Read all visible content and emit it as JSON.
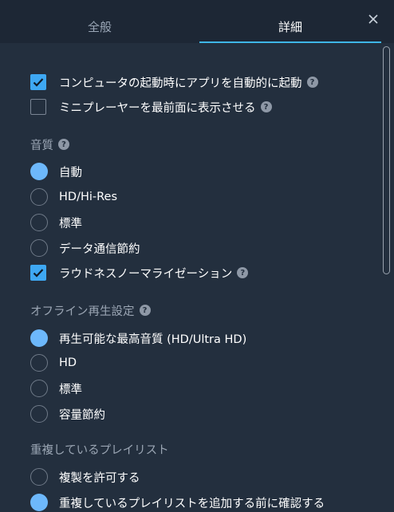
{
  "tabs": {
    "general": "全般",
    "advanced": "詳細"
  },
  "close_icon": "close-icon",
  "help_icon_text": "?",
  "startup": {
    "launch_on_startup": {
      "label": "コンピュータの起動時にアプリを自動的に起動",
      "checked": true
    },
    "mini_player_on_top": {
      "label": "ミニプレーヤーを最前面に表示させる",
      "checked": false
    }
  },
  "audio_quality": {
    "title": "音質",
    "options": [
      "自動",
      "HD/Hi-Res",
      "標準",
      "データ通信節約"
    ],
    "selected": "自動",
    "loudness": {
      "label": "ラウドネスノーマライゼーション",
      "checked": true
    }
  },
  "offline": {
    "title": "オフライン再生設定",
    "options": [
      "再生可能な最高音質 (HD/Ultra HD)",
      "HD",
      "標準",
      "容量節約"
    ],
    "selected": "再生可能な最高音質 (HD/Ultra HD)"
  },
  "duplicates": {
    "title": "重複しているプレイリスト",
    "options": [
      "複製を許可する",
      "重複しているプレイリストを追加する前に確認する"
    ],
    "selected": "重複しているプレイリストを追加する前に確認する"
  },
  "colors": {
    "accent": "#3fb6e6",
    "checkbox": "#3ea8f3",
    "radio": "#6db8fb",
    "background": "#232f3e"
  }
}
